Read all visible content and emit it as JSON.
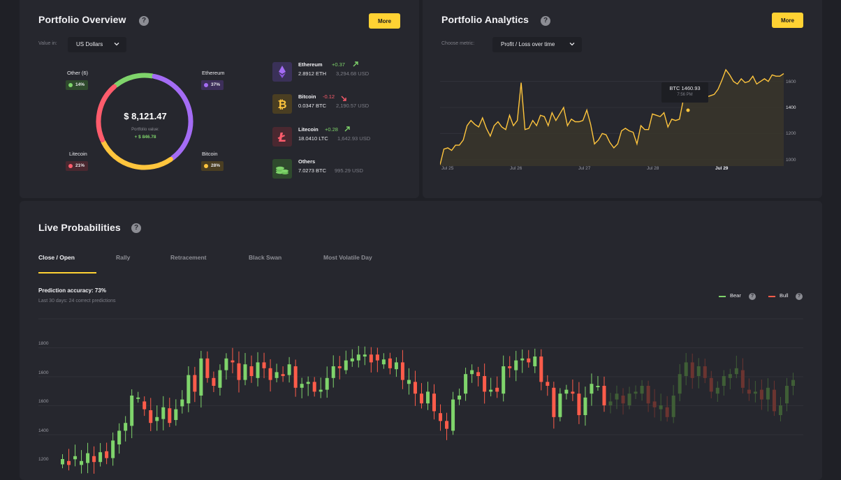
{
  "overview": {
    "title": "Portfolio Overview",
    "help": "?",
    "more_label": "More",
    "value_in_label": "Value in:",
    "currency_select": "US Dollars",
    "total_value": "$ 8,121.47",
    "total_label": "Portfolio value:",
    "total_change": "+ $ 846.78",
    "segments": [
      {
        "name": "Other (6)",
        "pct": "14%",
        "fraction": 0.14,
        "color": "#7fd46b"
      },
      {
        "name": "Ethereum",
        "pct": "37%",
        "fraction": 0.37,
        "color": "#a46cf5"
      },
      {
        "name": "Bitcoin",
        "pct": "28%",
        "fraction": 0.28,
        "color": "#ffc53d"
      },
      {
        "name": "Litecoin",
        "pct": "21%",
        "fraction": 0.21,
        "color": "#ff5c6c"
      }
    ],
    "coins": [
      {
        "name": "Ethereum",
        "change": "+0.37",
        "direction": "up",
        "amount": "2.8912 ETH",
        "usd": "3,294.68 USD",
        "icon": "ethereum-icon"
      },
      {
        "name": "Bitcoin",
        "change": "-0.12",
        "direction": "down",
        "amount": "0.0347 BTC",
        "usd": "2,190.57 USD",
        "icon": "bitcoin-icon"
      },
      {
        "name": "Litecoin",
        "change": "+0.28",
        "direction": "up",
        "amount": "18.0410 LTC",
        "usd": "1,642.93 USD",
        "icon": "litecoin-icon"
      },
      {
        "name": "Others",
        "change": "",
        "direction": "",
        "amount": "7.0273 BTC",
        "usd": "995.29 USD",
        "icon": "coins-stack-icon"
      }
    ]
  },
  "analytics": {
    "title": "Portfolio Analytics",
    "help": "?",
    "more_label": "More",
    "metric_label": "Choose metric:",
    "metric_select": "Profit / Loss over time",
    "tooltip_value": "BTC 1460.93",
    "tooltip_time": "7:56 PM",
    "y_ticks": [
      "1600",
      "1400",
      "1200",
      "1000"
    ],
    "x_ticks": [
      "Jul 25",
      "Jul 26",
      "Jul 27",
      "Jul 28",
      "Jul 29"
    ],
    "line_color": "#ffc53d"
  },
  "live": {
    "title": "Live Probabilities",
    "help": "?",
    "tabs": [
      "Close / Open",
      "Rally",
      "Retracement",
      "Black Swan",
      "Most Volatile Day"
    ],
    "accuracy": "Prediction accuracy: 73%",
    "accuracy_sub": "Last 30 days: 24 correct predictions",
    "legend": [
      {
        "label": "Bear",
        "color": "#7fd46b"
      },
      {
        "label": "Bull",
        "color": "#ff5c4a"
      }
    ],
    "y_ticks": [
      "1800",
      "1600",
      "1600",
      "1400",
      "1200"
    ]
  },
  "chart_data": [
    {
      "type": "area",
      "title": "",
      "xlabel": "",
      "ylabel": "",
      "ylim": [
        950,
        1700
      ],
      "x_range": [
        "Jul 25",
        "Jul 29"
      ],
      "series": [
        {
          "name": "",
          "values": [
            960,
            1080,
            1090,
            1070,
            1110,
            1110,
            1150,
            1260,
            1300,
            1270,
            1250,
            1320,
            1240,
            1180,
            1260,
            1290,
            1250,
            1230,
            1340,
            1260,
            1300,
            1590,
            1230,
            1240,
            1300,
            1260,
            1340,
            1330,
            1260,
            1360,
            1300,
            1350,
            1400,
            1260,
            1310,
            1290,
            1290,
            1300,
            1380,
            1270,
            1120,
            1150,
            1200,
            1190,
            1130,
            1090,
            1120,
            1220,
            1240,
            1220,
            1210,
            1120,
            1260,
            1230,
            1230,
            1350,
            1340,
            1330,
            1360,
            1250,
            1310,
            1300,
            1310,
            1460,
            1460,
            1450,
            1530,
            1520,
            1460,
            1480,
            1490,
            1500,
            1540,
            1610,
            1690,
            1650,
            1600,
            1580,
            1620,
            1590,
            1600,
            1640,
            1580,
            1600,
            1620,
            1600,
            1650,
            1640,
            1640,
            1660
          ]
        }
      ],
      "grid": true
    },
    {
      "type": "candlestick",
      "title": "",
      "ylim": [
        1150,
        1950
      ],
      "y_tick_labels": [
        "1800",
        "1600",
        "1600",
        "1400",
        "1200"
      ],
      "series": [
        {
          "name": "candles",
          "open": [
            1198,
            1215,
            1224,
            1195,
            1205,
            1240,
            1210,
            1265,
            1230,
            1300,
            1370,
            1395,
            1540,
            1520,
            1475,
            1420,
            1430,
            1485,
            1425,
            1495,
            1510,
            1655,
            1550,
            1740,
            1640,
            1590,
            1680,
            1730,
            1715,
            1630,
            1700,
            1640,
            1720,
            1690,
            1640,
            1660,
            1655,
            1700,
            1590,
            1610,
            1620,
            1570,
            1580,
            1640,
            1700,
            1680,
            1725,
            1730,
            1750,
            1760,
            1760,
            1710,
            1740,
            1685,
            1720,
            1610,
            1620,
            1560,
            1510,
            1560,
            1460,
            1420,
            1370,
            1530,
            1560,
            1660,
            1670,
            1650,
            1570,
            1590,
            1560,
            1700,
            1680,
            1730,
            1740,
            1700,
            1750,
            1620,
            1590,
            1440,
            1560,
            1570,
            1560,
            1450,
            1560,
            1600,
            1600,
            1500,
            1530,
            1550,
            1500,
            1560,
            1560,
            1600,
            1520,
            1480,
            1490,
            1440,
            1560,
            1650,
            1720,
            1650,
            1700,
            1640,
            1560,
            1600,
            1640,
            1660,
            1680,
            1580,
            1560,
            1580,
            1530,
            1580,
            1450,
            1510,
            1600
          ],
          "close": [
            1225,
            1195,
            1240,
            1215,
            1255,
            1210,
            1260,
            1230,
            1320,
            1370,
            1410,
            1550,
            1540,
            1480,
            1410,
            1440,
            1490,
            1410,
            1480,
            1530,
            1655,
            1570,
            1740,
            1640,
            1600,
            1680,
            1740,
            1720,
            1630,
            1710,
            1650,
            1720,
            1690,
            1630,
            1670,
            1650,
            1710,
            1590,
            1610,
            1620,
            1570,
            1580,
            1640,
            1700,
            1690,
            1730,
            1740,
            1760,
            1760,
            1720,
            1730,
            1735,
            1690,
            1720,
            1630,
            1630,
            1560,
            1510,
            1570,
            1470,
            1420,
            1380,
            1530,
            1550,
            1660,
            1680,
            1650,
            1570,
            1580,
            1570,
            1700,
            1690,
            1730,
            1740,
            1720,
            1750,
            1620,
            1600,
            1440,
            1560,
            1580,
            1560,
            1450,
            1540,
            1610,
            1600,
            1500,
            1520,
            1560,
            1510,
            1560,
            1570,
            1600,
            1510,
            1490,
            1500,
            1440,
            1550,
            1660,
            1720,
            1640,
            1700,
            1640,
            1570,
            1590,
            1650,
            1660,
            1690,
            1590,
            1560,
            1570,
            1530,
            1590,
            1470,
            1500,
            1600,
            1630
          ]
        }
      ]
    }
  ]
}
